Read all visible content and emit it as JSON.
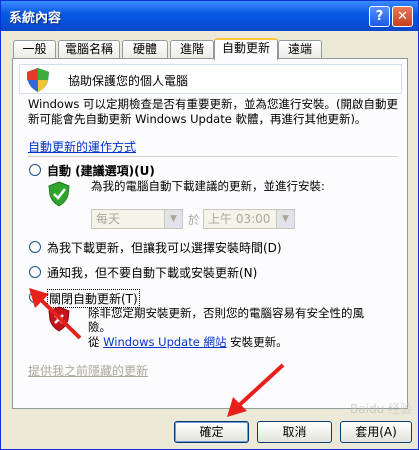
{
  "window": {
    "title": "系統內容",
    "help_glyph": "?",
    "close_glyph": "✕"
  },
  "tabs": [
    {
      "label": "一般"
    },
    {
      "label": "電腦名稱"
    },
    {
      "label": "硬體"
    },
    {
      "label": "進階"
    },
    {
      "label": "自動更新",
      "active": true
    },
    {
      "label": "遠端"
    }
  ],
  "header": {
    "text": "協助保護您的個人電腦"
  },
  "description": "Windows 可以定期檢查是否有重要更新，並為您進行安裝。(開啟自動更新可能會先自動更新 Windows Update 軟體，再進行其他更新)。",
  "how_it_works_link": "自動更新的運作方式",
  "options": {
    "automatic": {
      "label": "自動 (建議選項)(U)",
      "desc": "為我的電腦自動下載建議的更新，並進行安裝:",
      "day": "每天",
      "at_label": "於",
      "time": "上午 03:00"
    },
    "download": {
      "label": "為我下載更新，但讓我可以選擇安裝時間(D)"
    },
    "notify": {
      "label": "通知我，但不要自動下載或安裝更新(N)"
    },
    "off": {
      "label": "關閉自動更新(T)",
      "desc": "除非您定期安裝更新，否則您的電腦容易有安全性的風險。",
      "desc2_prefix": "從",
      "desc2_link": "Windows Update 網站",
      "desc2_suffix": "安裝更新。"
    }
  },
  "hidden_updates_link": "提供我之前隱藏的更新",
  "buttons": {
    "ok": "確定",
    "cancel": "取消",
    "apply": "套用(A)"
  },
  "watermark": "Baidu 经验",
  "colors": {
    "title_blue": "#0A5BE0",
    "link": "#0033CC",
    "arrow": "#E8201C"
  }
}
